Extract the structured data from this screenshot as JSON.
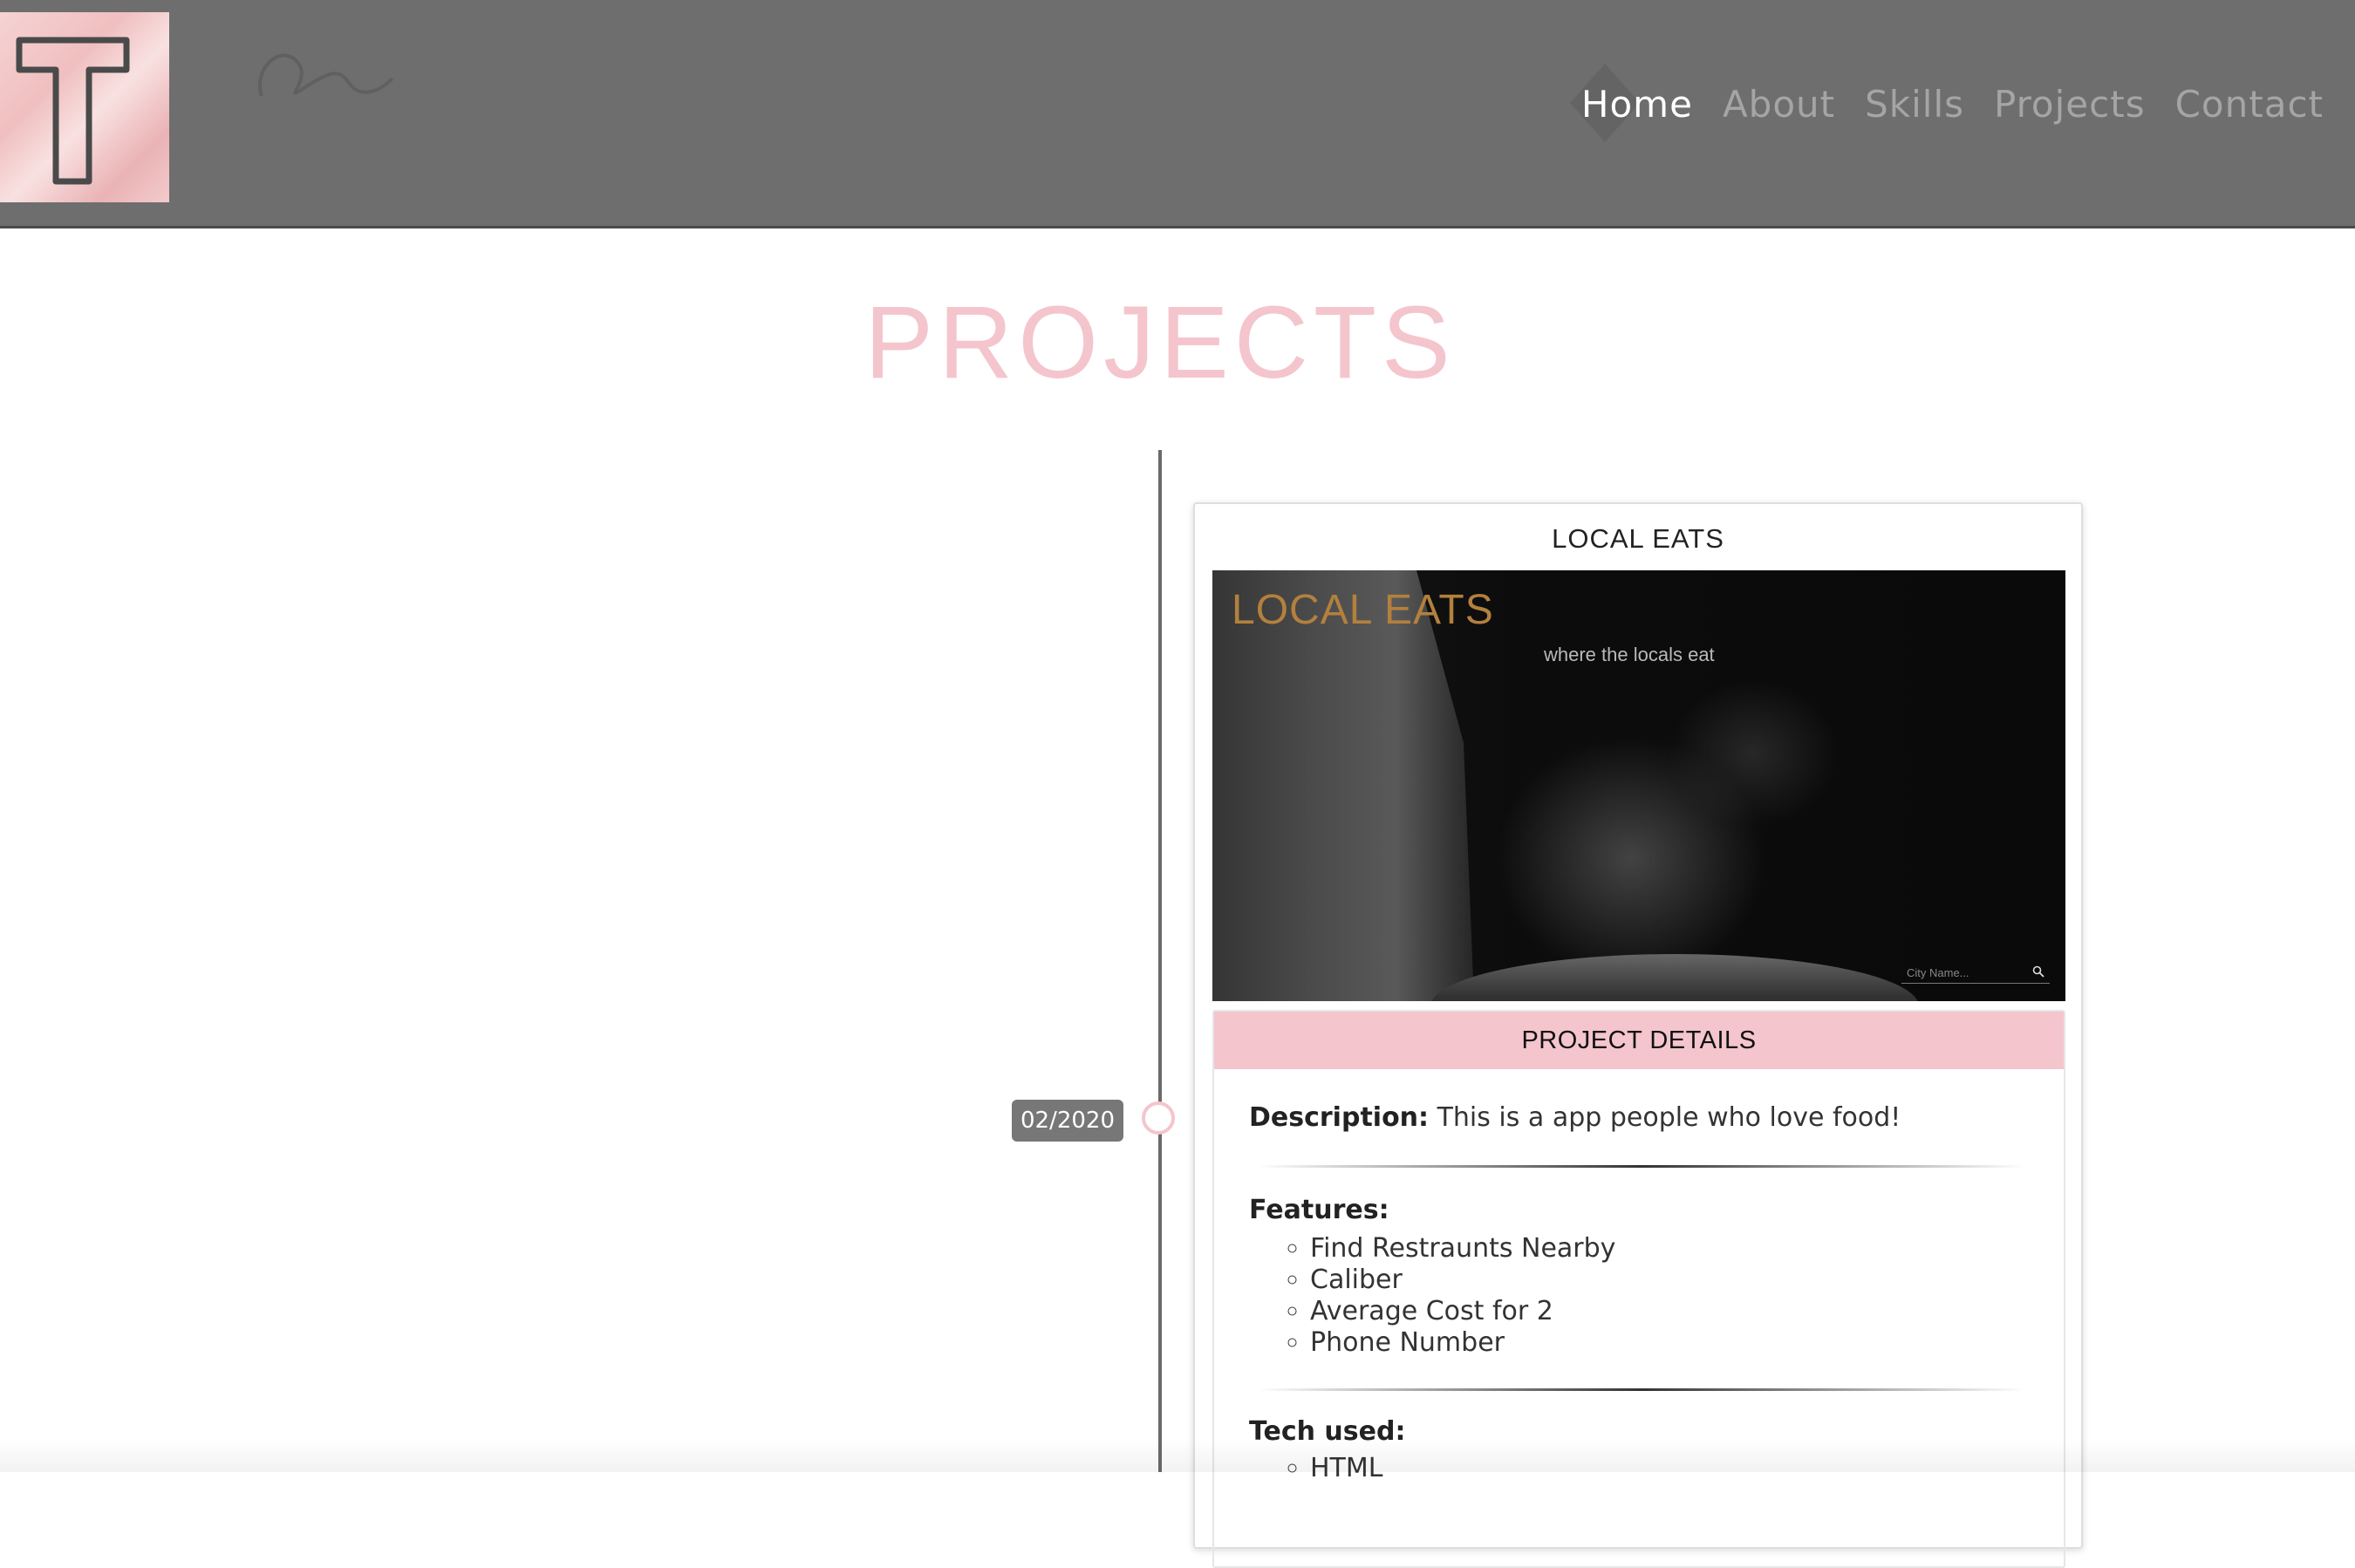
{
  "header": {
    "logo_letter": "T",
    "nav": [
      {
        "label": "Home",
        "active": true
      },
      {
        "label": "About",
        "active": false
      },
      {
        "label": "Skills",
        "active": false
      },
      {
        "label": "Projects",
        "active": false
      },
      {
        "label": "Contact",
        "active": false
      }
    ]
  },
  "page": {
    "title": "PROJECTS"
  },
  "timeline": {
    "entries": [
      {
        "date": "02/2020",
        "project": {
          "title": "LOCAL EATS",
          "screenshot": {
            "hero_title": "LOCAL EATS",
            "tagline": "where the locals eat",
            "search_placeholder": "City Name..."
          },
          "details_header": "PROJECT DETAILS",
          "description_label": "Description:",
          "description_text": "This is a app people who love food!",
          "features_label": "Features:",
          "features": [
            "Find Restraunts Nearby",
            "Caliber",
            "Average Cost for 2",
            "Phone Number"
          ],
          "tech_label": "Tech used:",
          "tech": [
            "HTML"
          ]
        }
      }
    ]
  },
  "colors": {
    "navbar_bg": "#6e6e6e",
    "accent_pink": "#f4c5cd",
    "nav_active": "#ffffff",
    "nav_inactive": "#a5a5a5",
    "hero_gold": "#b3803e",
    "date_badge_bg": "#777777"
  },
  "icons": {
    "logo": "letter-t-logo",
    "search": "search-icon",
    "timeline_marker": "circle-marker"
  }
}
